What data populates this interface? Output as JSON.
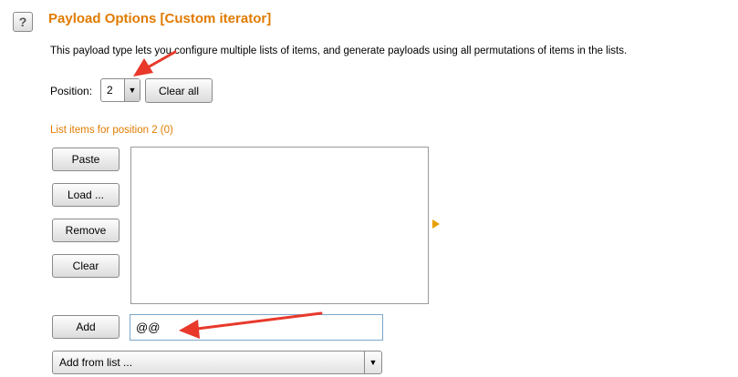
{
  "header": {
    "help_label": "?",
    "title": "Payload Options [Custom iterator]"
  },
  "description": "This payload type lets you configure multiple lists of items, and generate payloads using all permutations of items in the lists.",
  "position": {
    "label": "Position:",
    "selected": "2",
    "clear_all_label": "Clear all"
  },
  "list": {
    "heading": "List items for position 2 (0)",
    "buttons": {
      "paste": "Paste",
      "load": "Load ...",
      "remove": "Remove",
      "clear": "Clear",
      "add": "Add"
    },
    "add_input_value": "@@",
    "add_from_list": "Add from list ..."
  },
  "icons": {
    "help": "question-mark-icon",
    "combo_arrow": "triangle-down-icon",
    "expand": "triangle-right-icon",
    "annotation_arrow": "red-arrow-icon"
  },
  "colors": {
    "accent": "#e07b00",
    "annotation": "#e8392b"
  }
}
